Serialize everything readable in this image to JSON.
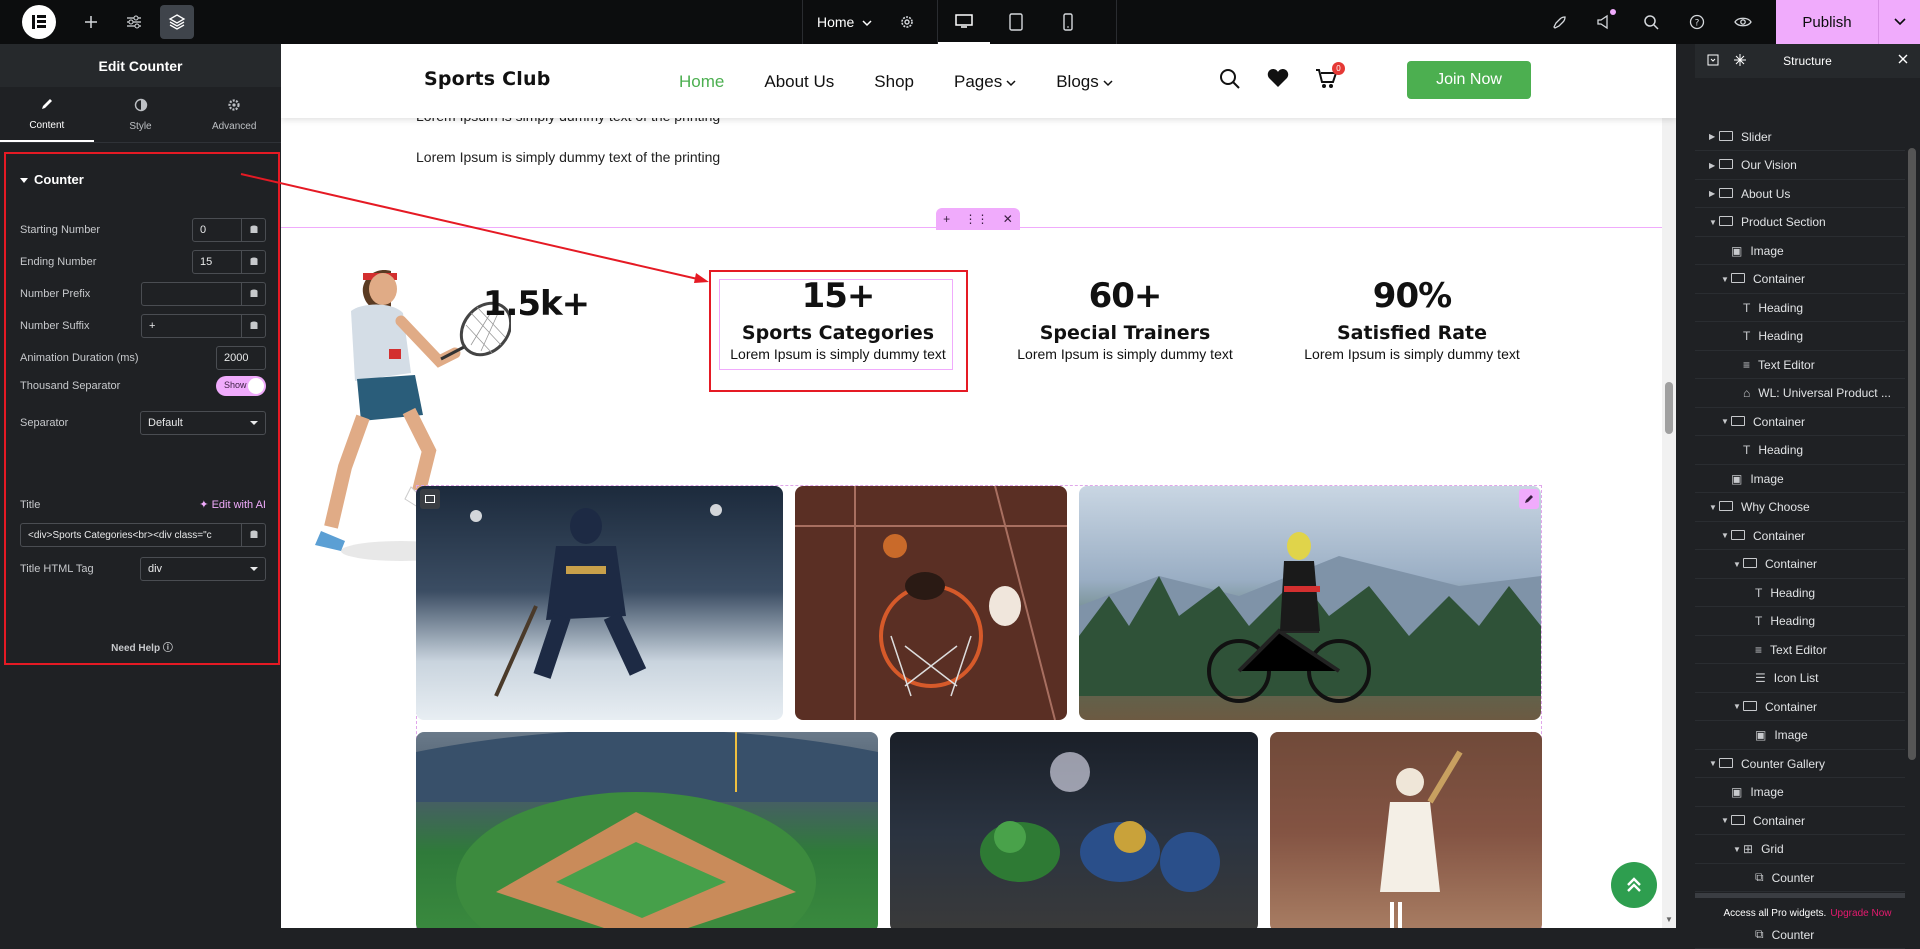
{
  "topbar": {
    "page_name": "Home",
    "publish_label": "Publish"
  },
  "left_panel": {
    "title": "Edit Counter",
    "tabs": [
      {
        "label": "Content"
      },
      {
        "label": "Style"
      },
      {
        "label": "Advanced"
      }
    ],
    "section_title": "Counter",
    "starting_number_label": "Starting Number",
    "starting_number_value": "0",
    "ending_number_label": "Ending Number",
    "ending_number_value": "15",
    "prefix_label": "Number Prefix",
    "prefix_value": "",
    "suffix_label": "Number Suffix",
    "suffix_value": "+",
    "duration_label": "Animation Duration (ms)",
    "duration_value": "2000",
    "thousand_label": "Thousand Separator",
    "thousand_value": "Show",
    "separator_label": "Separator",
    "separator_value": "Default",
    "title_label": "Title",
    "edit_ai_label": "Edit with AI",
    "title_value": "<div>Sports Categories<br><div class=\"c",
    "html_tag_label": "Title HTML Tag",
    "html_tag_value": "div",
    "need_help": "Need Help"
  },
  "site": {
    "brand": "Sports Club",
    "nav": [
      {
        "label": "Home",
        "active": true
      },
      {
        "label": "About Us"
      },
      {
        "label": "Shop"
      },
      {
        "label": "Pages",
        "dropdown": true
      },
      {
        "label": "Blogs",
        "dropdown": true
      }
    ],
    "cart_count": "0",
    "join_label": "Join Now",
    "lorem_1": "Lorem Ipsum is simply dummy text of the printing",
    "lorem_2": "Lorem Ipsum is simply dummy text of the printing",
    "counters": [
      {
        "number": "1.5k+",
        "title": "",
        "text": ""
      },
      {
        "number": "15+",
        "title": "Sports Categories",
        "text": "Lorem Ipsum is simply dummy text"
      },
      {
        "number": "60+",
        "title": "Special Trainers",
        "text": "Lorem Ipsum is simply dummy text"
      },
      {
        "number": "90%",
        "title": "Satisfied Rate",
        "text": "Lorem Ipsum is simply dummy text"
      }
    ]
  },
  "structure": {
    "title": "Structure",
    "items": [
      {
        "label": "Slider",
        "depth": 0,
        "icon": "container",
        "toggle": "collapsed"
      },
      {
        "label": "Our Vision",
        "depth": 0,
        "icon": "container",
        "toggle": "collapsed"
      },
      {
        "label": "About Us",
        "depth": 0,
        "icon": "container",
        "toggle": "collapsed"
      },
      {
        "label": "Product Section",
        "depth": 0,
        "icon": "container",
        "toggle": "expanded"
      },
      {
        "label": "Image",
        "depth": 1,
        "icon": "image"
      },
      {
        "label": "Container",
        "depth": 1,
        "icon": "container",
        "toggle": "expanded"
      },
      {
        "label": "Heading",
        "depth": 2,
        "icon": "heading"
      },
      {
        "label": "Heading",
        "depth": 2,
        "icon": "heading"
      },
      {
        "label": "Text Editor",
        "depth": 2,
        "icon": "text"
      },
      {
        "label": "WL: Universal Product ...",
        "depth": 2,
        "icon": "widget"
      },
      {
        "label": "Container",
        "depth": 1,
        "icon": "container",
        "toggle": "expanded"
      },
      {
        "label": "Heading",
        "depth": 2,
        "icon": "heading"
      },
      {
        "label": "Image",
        "depth": 1,
        "icon": "image"
      },
      {
        "label": "Why Choose",
        "depth": 0,
        "icon": "container",
        "toggle": "expanded"
      },
      {
        "label": "Container",
        "depth": 1,
        "icon": "container",
        "toggle": "expanded"
      },
      {
        "label": "Container",
        "depth": 2,
        "icon": "container",
        "toggle": "expanded"
      },
      {
        "label": "Heading",
        "depth": 3,
        "icon": "heading"
      },
      {
        "label": "Heading",
        "depth": 3,
        "icon": "heading"
      },
      {
        "label": "Text Editor",
        "depth": 3,
        "icon": "text"
      },
      {
        "label": "Icon List",
        "depth": 3,
        "icon": "list"
      },
      {
        "label": "Container",
        "depth": 2,
        "icon": "container",
        "toggle": "expanded"
      },
      {
        "label": "Image",
        "depth": 3,
        "icon": "image"
      },
      {
        "label": "Counter Gallery",
        "depth": 0,
        "icon": "container",
        "toggle": "expanded"
      },
      {
        "label": "Image",
        "depth": 1,
        "icon": "image"
      },
      {
        "label": "Container",
        "depth": 1,
        "icon": "container",
        "toggle": "expanded"
      },
      {
        "label": "Grid",
        "depth": 2,
        "icon": "grid",
        "toggle": "expanded"
      },
      {
        "label": "Counter",
        "depth": 3,
        "icon": "counter"
      },
      {
        "label": "Counter",
        "depth": 3,
        "icon": "counter",
        "selected": true
      },
      {
        "label": "Counter",
        "depth": 3,
        "icon": "counter"
      }
    ],
    "footer_text": "Access all Pro widgets.",
    "footer_link": "Upgrade Now"
  },
  "colors": {
    "accent_pink": "#f0abfc",
    "highlight_red": "#e51a24",
    "nav_active_green": "#4caf50"
  }
}
